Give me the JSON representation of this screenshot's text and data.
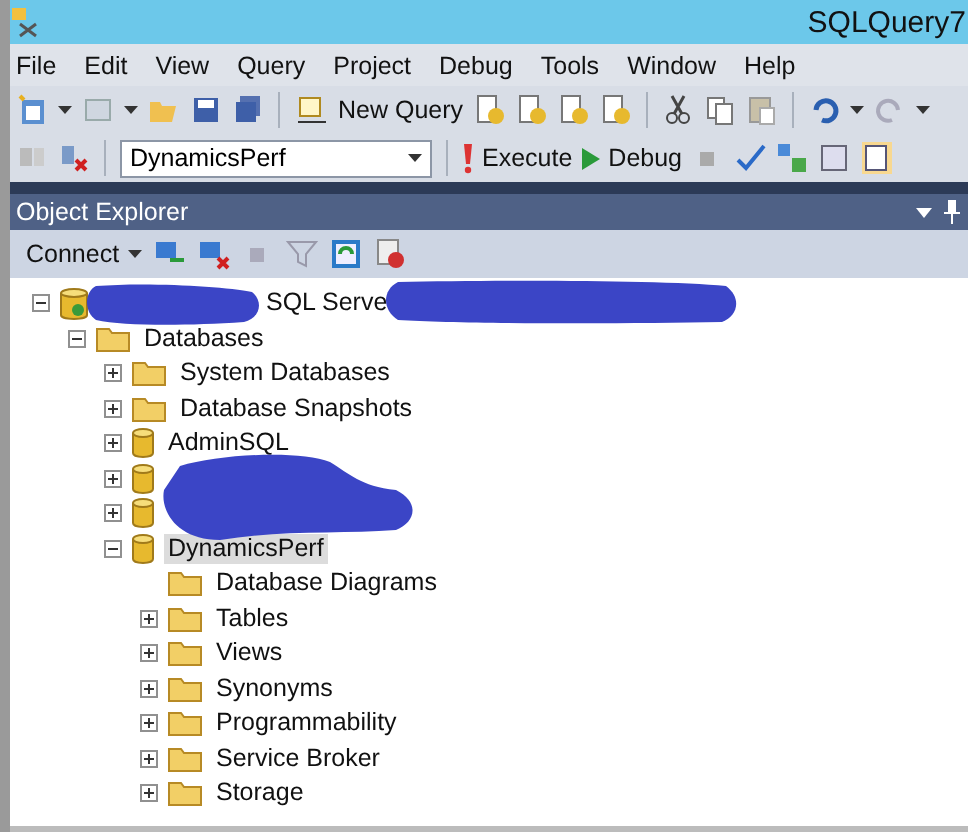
{
  "window": {
    "title": "SQLQuery7"
  },
  "menu": [
    "File",
    "Edit",
    "View",
    "Query",
    "Project",
    "Debug",
    "Tools",
    "Window",
    "Help"
  ],
  "toolbar": {
    "new_query": "New Query",
    "database": "DynamicsPerf",
    "execute": "Execute",
    "debug": "Debug"
  },
  "object_explorer": {
    "title": "Object Explorer",
    "connect": "Connect",
    "tree": [
      {
        "label": "SQL Serve",
        "kind": "server",
        "expanded": true,
        "selected": false,
        "children": [
          {
            "label": "Databases",
            "kind": "folder",
            "expanded": true,
            "selected": false,
            "children": [
              {
                "label": "System Databases",
                "kind": "folder",
                "expanded": false,
                "selected": false
              },
              {
                "label": "Database Snapshots",
                "kind": "folder",
                "expanded": false,
                "selected": false
              },
              {
                "label": "AdminSQL",
                "kind": "database",
                "expanded": false,
                "selected": false
              },
              {
                "kind": "database",
                "expanded": false
              },
              {
                "kind": "database",
                "expanded": false
              },
              {
                "label": "DynamicsPerf",
                "kind": "database",
                "expanded": true,
                "selected": true,
                "children": [
                  {
                    "label": "Database Diagrams",
                    "kind": "folder",
                    "selected": false
                  },
                  {
                    "label": "Tables",
                    "kind": "folder",
                    "expanded": false,
                    "selected": false
                  },
                  {
                    "label": "Views",
                    "kind": "folder",
                    "expanded": false,
                    "selected": false
                  },
                  {
                    "label": "Synonyms",
                    "kind": "folder",
                    "expanded": false,
                    "selected": false
                  },
                  {
                    "label": "Programmability",
                    "kind": "folder",
                    "expanded": false,
                    "selected": false
                  },
                  {
                    "label": "Service Broker",
                    "kind": "folder",
                    "expanded": false,
                    "selected": false
                  },
                  {
                    "label": "Storage",
                    "kind": "folder",
                    "expanded": false,
                    "selected": false
                  }
                ]
              }
            ]
          }
        ]
      }
    ]
  }
}
